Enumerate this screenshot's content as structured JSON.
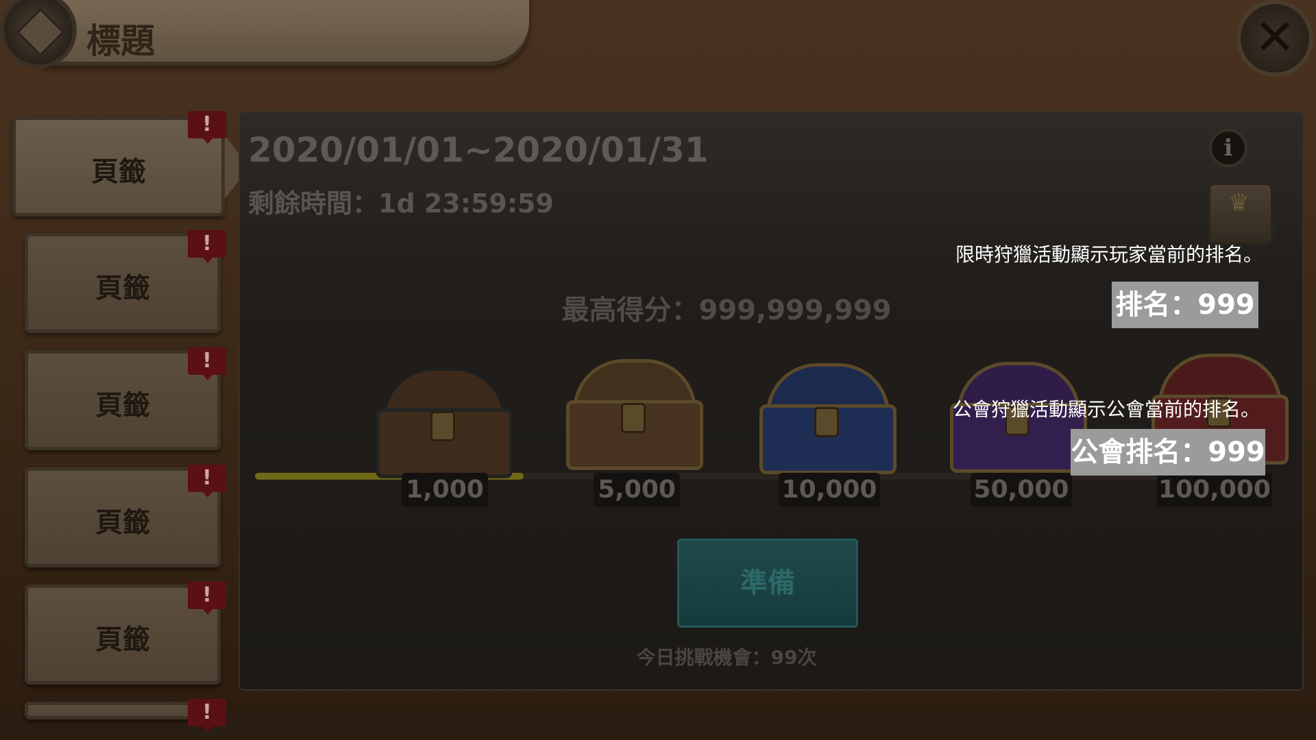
{
  "header": {
    "title": "標題",
    "close_icon": "close-icon"
  },
  "sidebar": {
    "tabs": [
      {
        "label": "頁籤",
        "badge": "!"
      },
      {
        "label": "頁籤",
        "badge": "!"
      },
      {
        "label": "頁籤",
        "badge": "!"
      },
      {
        "label": "頁籤",
        "badge": "!"
      },
      {
        "label": "頁籤",
        "badge": "!"
      },
      {
        "label": "",
        "badge": "!"
      }
    ]
  },
  "event": {
    "date_range": "2020/01/01~2020/01/31",
    "remaining": "剩餘時間：1d 23:59:59",
    "high_score": "最高得分：999,999,999",
    "info_icon": "i",
    "milestones": [
      "1,000",
      "5,000",
      "10,000",
      "50,000",
      "100,000"
    ],
    "progress_fraction": 0.27,
    "prepare_label": "準備",
    "chances": "今日挑戰機會：99次"
  },
  "annotations": {
    "player_note": "限時狩獵活動顯示玩家當前的排名。",
    "player_rank": "排名：999",
    "guild_note": "公會狩獵活動顯示公會當前的排名。",
    "guild_rank": "公會排名：999"
  },
  "colors": {
    "badge_red": "#5a1014",
    "progress": "#6e6a18",
    "prepare_teal": "#1f4a4a",
    "annotation_box": "#9b9b9b"
  }
}
